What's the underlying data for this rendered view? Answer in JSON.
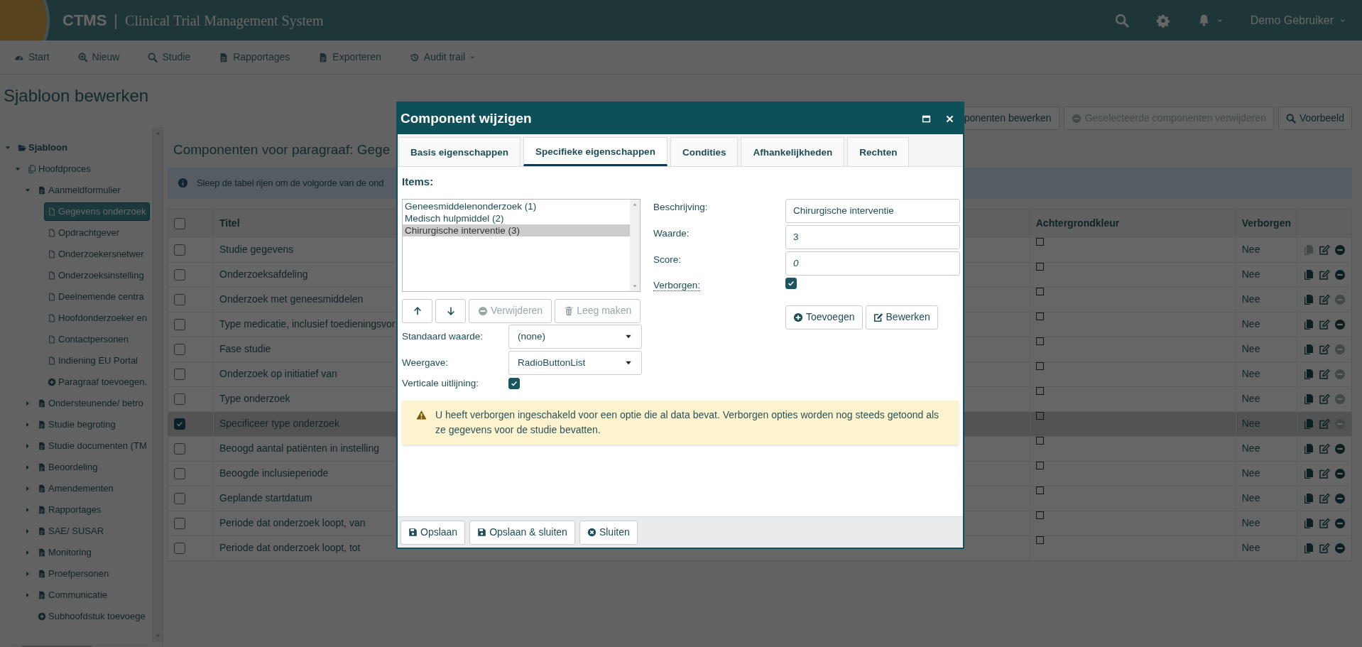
{
  "app": {
    "name": "CTMS",
    "separator": "|",
    "subtitle": "Clinical Trial Management System",
    "user": "Demo Gebruiker"
  },
  "toolbar": [
    {
      "label": "Start"
    },
    {
      "label": "Nieuw"
    },
    {
      "label": "Studie"
    },
    {
      "label": "Rapportages"
    },
    {
      "label": "Exporteren"
    },
    {
      "label": "Audit trail"
    }
  ],
  "page_title": "Sjabloon bewerken",
  "sidebar": {
    "tree": [
      {
        "kind": "template",
        "label": "Sjabloon",
        "expanded": true,
        "selected": false,
        "children": [
          {
            "kind": "process",
            "label": "Hoofdproces",
            "expanded": true,
            "selected": false,
            "children": [
              {
                "kind": "form",
                "label": "Aanmeldformulier",
                "expanded": true,
                "selected": false,
                "children": [
                  {
                    "kind": "paragraph",
                    "label": "Gegevens onderzoek",
                    "selected": true
                  },
                  {
                    "kind": "paragraph",
                    "label": "Opdrachtgever",
                    "selected": false
                  },
                  {
                    "kind": "paragraph",
                    "label": "Onderzoekersnetwer",
                    "selected": false
                  },
                  {
                    "kind": "paragraph",
                    "label": "Onderzoeksinstelling",
                    "selected": false
                  },
                  {
                    "kind": "paragraph",
                    "label": "Deelnemende centra",
                    "selected": false
                  },
                  {
                    "kind": "paragraph",
                    "label": "Hoofdonderzoeker en",
                    "selected": false
                  },
                  {
                    "kind": "paragraph",
                    "label": "Contactpersonen",
                    "selected": false
                  },
                  {
                    "kind": "paragraph",
                    "label": "Indiening EU Portal",
                    "selected": false
                  },
                  {
                    "kind": "add",
                    "label": "Paragraaf toevoegen.",
                    "selected": false
                  }
                ]
              },
              {
                "kind": "form",
                "label": "Ondersteunende/ betro",
                "expanded": false,
                "selected": false
              },
              {
                "kind": "form",
                "label": "Studie begroting",
                "expanded": false,
                "selected": false
              },
              {
                "kind": "form",
                "label": "Studie documenten (TM",
                "expanded": false,
                "selected": false
              },
              {
                "kind": "form",
                "label": "Beoordeling",
                "expanded": false,
                "selected": false
              },
              {
                "kind": "form",
                "label": "Amendementen",
                "expanded": false,
                "selected": false
              },
              {
                "kind": "form",
                "label": "Rapportages",
                "expanded": false,
                "selected": false
              },
              {
                "kind": "form",
                "label": "SAE/ SUSAR",
                "expanded": false,
                "selected": false
              },
              {
                "kind": "form",
                "label": "Monitoring",
                "expanded": false,
                "selected": false
              },
              {
                "kind": "form",
                "label": "Proefpersonen",
                "expanded": false,
                "selected": false
              },
              {
                "kind": "form",
                "label": "Communicatie",
                "expanded": false,
                "selected": false
              },
              {
                "kind": "add",
                "label": "Subhoofdstuk toevoege",
                "selected": false
              }
            ]
          }
        ]
      }
    ]
  },
  "section_title": "Componenten voor paragraaf: Gege",
  "actions": [
    {
      "label": "ponenten bewerken",
      "disabled": false
    },
    {
      "label": "Geselecteerde componenten verwijderen",
      "disabled": true
    },
    {
      "label": "Voorbeeld",
      "disabled": false
    }
  ],
  "info": "Sleep de tabel rijen om de volgorde van de ond",
  "table": {
    "select_all_checked": false,
    "columns": [
      "Titel",
      "Achtergrondkleur",
      "Verborgen"
    ],
    "rows": [
      {
        "checked": false,
        "selected": false,
        "title": "Studie gegevens",
        "hidden": "Nee",
        "copy_disabled": true,
        "remove_disabled": false
      },
      {
        "checked": false,
        "selected": false,
        "title": "Onderzoeksafdeling",
        "hidden": "Nee",
        "copy_disabled": false,
        "remove_disabled": false
      },
      {
        "checked": false,
        "selected": false,
        "title": "Onderzoek met geneesmiddelen",
        "hidden": "Nee",
        "copy_disabled": false,
        "remove_disabled": true
      },
      {
        "checked": false,
        "selected": false,
        "title": "Type medicatie, inclusief toedieningsvor",
        "hidden": "Nee",
        "copy_disabled": false,
        "remove_disabled": false
      },
      {
        "checked": false,
        "selected": false,
        "title": "Fase studie",
        "hidden": "Nee",
        "copy_disabled": false,
        "remove_disabled": true
      },
      {
        "checked": false,
        "selected": false,
        "title": "Onderzoek op initiatief van",
        "hidden": "Nee",
        "copy_disabled": false,
        "remove_disabled": true
      },
      {
        "checked": false,
        "selected": false,
        "title": "Type onderzoek",
        "hidden": "Nee",
        "copy_disabled": false,
        "remove_disabled": true
      },
      {
        "checked": true,
        "selected": true,
        "title": "Specificeer type onderzoek",
        "hidden": "Nee",
        "copy_disabled": false,
        "remove_disabled": true
      },
      {
        "checked": false,
        "selected": false,
        "title": "Beoogd aantal patiënten in instelling",
        "hidden": "Nee",
        "copy_disabled": false,
        "remove_disabled": false
      },
      {
        "checked": false,
        "selected": false,
        "title": "Beoogde inclusieperiode",
        "hidden": "Nee",
        "copy_disabled": false,
        "remove_disabled": false
      },
      {
        "checked": false,
        "selected": false,
        "title": "Geplande startdatum",
        "hidden": "Nee",
        "copy_disabled": false,
        "remove_disabled": false
      },
      {
        "checked": false,
        "selected": false,
        "title": "Periode dat onderzoek loopt, van",
        "hidden": "Nee",
        "copy_disabled": false,
        "remove_disabled": false
      },
      {
        "checked": false,
        "selected": false,
        "title": "Periode dat onderzoek loopt, tot",
        "hidden": "Nee",
        "copy_disabled": false,
        "remove_disabled": false
      }
    ]
  },
  "modal": {
    "title": "Component wijzigen",
    "tabs": [
      {
        "label": "Basis eigenschappen",
        "selected": false
      },
      {
        "label": "Specifieke eigenschappen",
        "selected": true
      },
      {
        "label": "Condities",
        "selected": false
      },
      {
        "label": "Afhankelijkheden",
        "selected": false
      },
      {
        "label": "Rechten",
        "selected": false
      }
    ],
    "items_label": "Items:",
    "items": [
      {
        "label": "Geneesmiddelenonderzoek (1)",
        "selected": false
      },
      {
        "label": "Medisch hulpmiddel (2)",
        "selected": false
      },
      {
        "label": "Chirurgische interventie (3)",
        "selected": true
      }
    ],
    "list_buttons": [
      {
        "kind": "up",
        "disabled": false
      },
      {
        "kind": "down",
        "disabled": false
      },
      {
        "kind": "remove",
        "label": "Verwijderen",
        "disabled": true
      },
      {
        "kind": "clear",
        "label": "Leeg maken",
        "disabled": true
      }
    ],
    "default_value": {
      "label": "Standaard waarde:",
      "value": "(none)"
    },
    "display": {
      "label": "Weergave:",
      "value": "RadioButtonList"
    },
    "vertical": {
      "label": "Verticale uitlijning:",
      "checked": true
    },
    "fields": [
      {
        "label": "Beschrijving:",
        "value": "Chirurgische interventie"
      },
      {
        "label": "Waarde:",
        "value": "3"
      },
      {
        "label": "Score:",
        "value": "0"
      }
    ],
    "hidden_option": {
      "label": "Verborgen:",
      "checked": true
    },
    "item_buttons": [
      {
        "kind": "add",
        "label": "Toevoegen"
      },
      {
        "kind": "edit",
        "label": "Bewerken"
      }
    ],
    "warning": "U heeft verborgen ingeschakeld voor een optie die al data bevat. Verborgen opties worden nog steeds getoond als ze gegevens voor de studie bevatten.",
    "footer": [
      {
        "kind": "save",
        "label": "Opslaan"
      },
      {
        "kind": "save",
        "label": "Opslaan & sluiten"
      },
      {
        "kind": "close",
        "label": "Sluiten"
      }
    ]
  }
}
